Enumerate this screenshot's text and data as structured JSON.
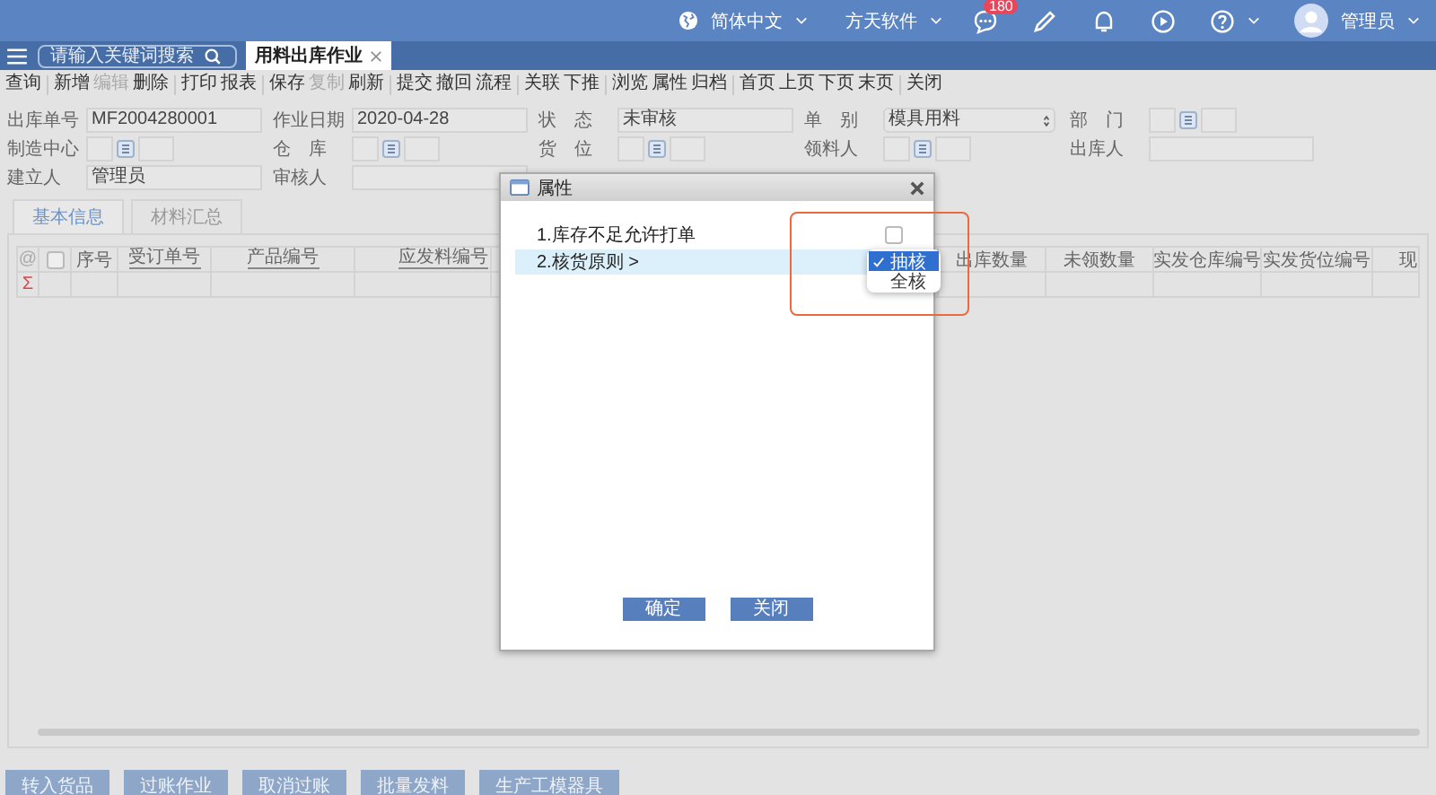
{
  "top_bar": {
    "language": "简体中文",
    "company": "方天软件",
    "message_count": "180",
    "user": "管理员"
  },
  "nav": {
    "search": {
      "placeholder": "请输入关键词搜索"
    },
    "tabs": [
      {
        "label": "用料出库作业",
        "selected": true
      }
    ]
  },
  "toolbar": [
    [
      {
        "label": "查询",
        "disabled": false
      }
    ],
    [
      {
        "label": "新增",
        "disabled": false
      },
      {
        "label": "编辑",
        "disabled": true
      },
      {
        "label": "删除",
        "disabled": false
      }
    ],
    [
      {
        "label": "打印",
        "disabled": false
      },
      {
        "label": "报表",
        "disabled": false
      }
    ],
    [
      {
        "label": "保存",
        "disabled": false
      },
      {
        "label": "复制",
        "disabled": true
      },
      {
        "label": "刷新",
        "disabled": false
      }
    ],
    [
      {
        "label": "提交",
        "disabled": false
      },
      {
        "label": "撤回",
        "disabled": false
      },
      {
        "label": "流程",
        "disabled": false
      }
    ],
    [
      {
        "label": "关联",
        "disabled": false
      },
      {
        "label": "下推",
        "disabled": false
      }
    ],
    [
      {
        "label": "浏览",
        "disabled": false
      },
      {
        "label": "属性",
        "disabled": false
      },
      {
        "label": "归档",
        "disabled": false
      }
    ],
    [
      {
        "label": "首页",
        "disabled": false
      },
      {
        "label": "上页",
        "disabled": false
      },
      {
        "label": "下页",
        "disabled": false
      },
      {
        "label": "末页",
        "disabled": false
      }
    ],
    [
      {
        "label": "关闭",
        "disabled": false
      }
    ]
  ],
  "form_rows": [
    [
      {
        "label": "出库单号",
        "kind": "text",
        "value": "MF2004280001"
      },
      {
        "label": "作业日期",
        "kind": "text",
        "value": "2020-04-28"
      },
      {
        "label": "状　态",
        "kind": "text",
        "value": "未审核"
      },
      {
        "label": "单　别",
        "kind": "select",
        "value": "模具用料"
      },
      {
        "label": "部　门",
        "kind": "lookup"
      }
    ],
    [
      {
        "label": "制造中心",
        "kind": "lookup"
      },
      {
        "label": "仓　库",
        "kind": "lookup"
      },
      {
        "label": "货　位",
        "kind": "lookup"
      },
      {
        "label": "领料人",
        "kind": "lookup"
      },
      {
        "label": "出库人",
        "kind": "text"
      }
    ],
    [
      {
        "label": "建立人",
        "kind": "text",
        "value": "管理员"
      },
      {
        "label": "审核人",
        "kind": "text"
      }
    ]
  ],
  "detail_tabs": [
    {
      "label": "基本信息",
      "selected": true
    },
    {
      "label": "材料汇总",
      "selected": false
    }
  ],
  "table": {
    "select_all_checked": false,
    "columns": [
      {
        "label": "@",
        "kind": "marker"
      },
      {
        "kind": "checkbox"
      },
      {
        "label": "序号",
        "kind": "text",
        "sortable": false
      },
      {
        "label": "受订单号",
        "kind": "text",
        "sortable": true
      },
      {
        "label": "产品编号",
        "kind": "text",
        "sortable": true
      },
      {
        "label": "应发料编号",
        "kind": "text",
        "sortable": true
      },
      {
        "kind": "hidden"
      },
      {
        "label": "出库数量",
        "kind": "text",
        "sortable": false
      },
      {
        "label": "未领数量",
        "kind": "text",
        "sortable": false
      },
      {
        "label": "实发仓库编号",
        "kind": "text",
        "sortable": false
      },
      {
        "label": "实发货位编号",
        "kind": "text",
        "sortable": false
      },
      {
        "label": "现",
        "kind": "text",
        "sortable": false
      }
    ],
    "sum_row": "Σ"
  },
  "bottom_buttons": [
    "转入货品",
    "过账作业",
    "取消过账",
    "批量发料",
    "生产工模器具"
  ],
  "dialog": {
    "title": "属性",
    "items": [
      {
        "label": "1.库存不足允许打单",
        "kind": "checkbox",
        "checked": false,
        "selected": false
      },
      {
        "label": "2.核货原则 >",
        "kind": "choice",
        "selected": true,
        "options": [
          {
            "label": "抽核",
            "selected": true
          },
          {
            "label": "全核",
            "selected": false
          }
        ]
      }
    ],
    "buttons": [
      "确定",
      "关闭"
    ]
  }
}
